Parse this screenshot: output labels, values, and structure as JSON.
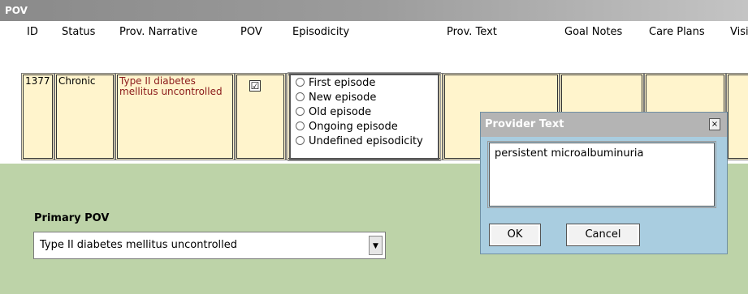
{
  "window": {
    "title": "POV"
  },
  "grid": {
    "headers": [
      "ID",
      "Status",
      "Prov. Narrative",
      "POV",
      "Episodicity",
      "Prov. Text",
      "Goal Notes",
      "Care Plans",
      "Visi"
    ],
    "row": {
      "id": "1377",
      "status": "Chronic",
      "narrative": "Type II diabetes mellitus uncontrolled",
      "pov_checked": "☑",
      "episodicity_options": [
        "First episode",
        "New episode",
        "Old episode",
        "Ongoing episode",
        "Undefined episodicity"
      ]
    }
  },
  "primary": {
    "label": "Primary POV",
    "selected": "Type II diabetes mellitus uncontrolled"
  },
  "dialog": {
    "title": "Provider Text",
    "close_glyph": "×",
    "text": "persistent microalbuminuria",
    "ok_label": "OK",
    "cancel_label": "Cancel"
  },
  "colors": {
    "row_bg": "#fff4cc",
    "panel_green": "#bdd3a8",
    "dialog_bg": "#a9cde0",
    "narrative_text": "#8b1a1a"
  }
}
